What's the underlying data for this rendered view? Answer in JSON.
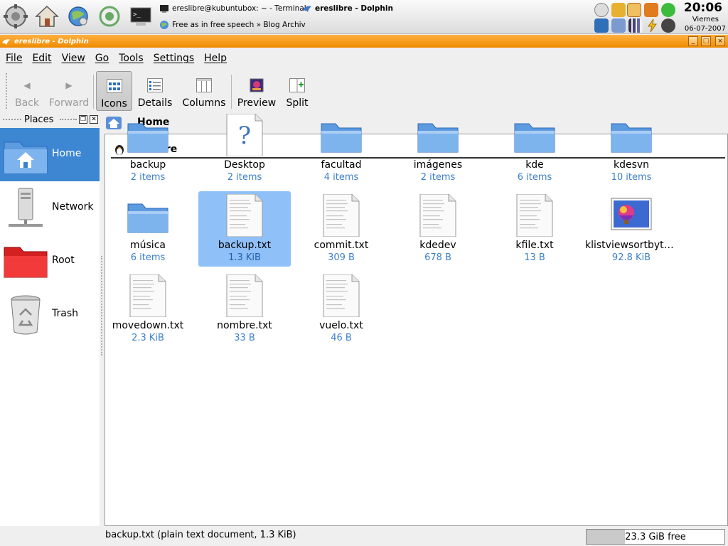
{
  "panel": {
    "launchers": [
      {
        "name": "kmenu-icon"
      },
      {
        "name": "home-icon"
      },
      {
        "name": "konqueror-icon"
      },
      {
        "name": "kopete-icon"
      },
      {
        "name": "terminal-icon"
      }
    ],
    "tasks": [
      {
        "title": "ereslibre@kubuntubox: ~ - Terminal"
      },
      {
        "title": "ereslibre - Dolphin"
      },
      {
        "title": "Free as in free speech » Blog Archiv"
      }
    ],
    "clock": {
      "time": "20:06",
      "day": "Viernes",
      "date": "06-07-2007"
    }
  },
  "window": {
    "title": "ereslibre - Dolphin",
    "buttons": {
      "minimize": "_",
      "maximize": "□",
      "close": "×"
    }
  },
  "menubar": [
    "File",
    "Edit",
    "View",
    "Go",
    "Tools",
    "Settings",
    "Help"
  ],
  "toolbar": {
    "back": "Back",
    "forward": "Forward",
    "icons": "Icons",
    "details": "Details",
    "columns": "Columns",
    "preview": "Preview",
    "split": "Split",
    "active_view": "Icons"
  },
  "places": {
    "title": "Places",
    "items": [
      {
        "label": "Home",
        "icon": "home-folder-icon",
        "selected": true
      },
      {
        "label": "Network",
        "icon": "network-server-icon",
        "selected": false
      },
      {
        "label": "Root",
        "icon": "red-folder-icon",
        "selected": false
      },
      {
        "label": "Trash",
        "icon": "trash-icon",
        "selected": false
      }
    ]
  },
  "location": {
    "text": "Home"
  },
  "view": {
    "title": "ereslibre",
    "items": [
      {
        "name": "backup",
        "meta": "2 items",
        "type": "folder",
        "selected": false
      },
      {
        "name": "Desktop",
        "meta": "2 items",
        "type": "unknown",
        "selected": false
      },
      {
        "name": "facultad",
        "meta": "4 items",
        "type": "folder",
        "selected": false
      },
      {
        "name": "imágenes",
        "meta": "2 items",
        "type": "folder",
        "selected": false
      },
      {
        "name": "kde",
        "meta": "6 items",
        "type": "folder",
        "selected": false
      },
      {
        "name": "kdesvn",
        "meta": "10 items",
        "type": "folder",
        "selected": false
      },
      {
        "name": "música",
        "meta": "6 items",
        "type": "folder",
        "selected": false
      },
      {
        "name": "backup.txt",
        "meta": "1.3 KiB",
        "type": "text",
        "selected": true
      },
      {
        "name": "commit.txt",
        "meta": "309 B",
        "type": "text",
        "selected": false
      },
      {
        "name": "kdedev",
        "meta": "678 B",
        "type": "text",
        "selected": false
      },
      {
        "name": "kfile.txt",
        "meta": "13 B",
        "type": "text",
        "selected": false
      },
      {
        "name": "klistviewsortbyty...",
        "meta": "92.8 KiB",
        "type": "image",
        "selected": false
      },
      {
        "name": "movedown.txt",
        "meta": "2.3 KiB",
        "type": "text",
        "selected": false
      },
      {
        "name": "nombre.txt",
        "meta": "33 B",
        "type": "text",
        "selected": false
      },
      {
        "name": "vuelo.txt",
        "meta": "46 B",
        "type": "text",
        "selected": false
      }
    ]
  },
  "status": {
    "text": "backup.txt (plain text document, 1.3 KiB)",
    "free_space": "23.3 GiB free",
    "used_fraction": 0.28
  }
}
